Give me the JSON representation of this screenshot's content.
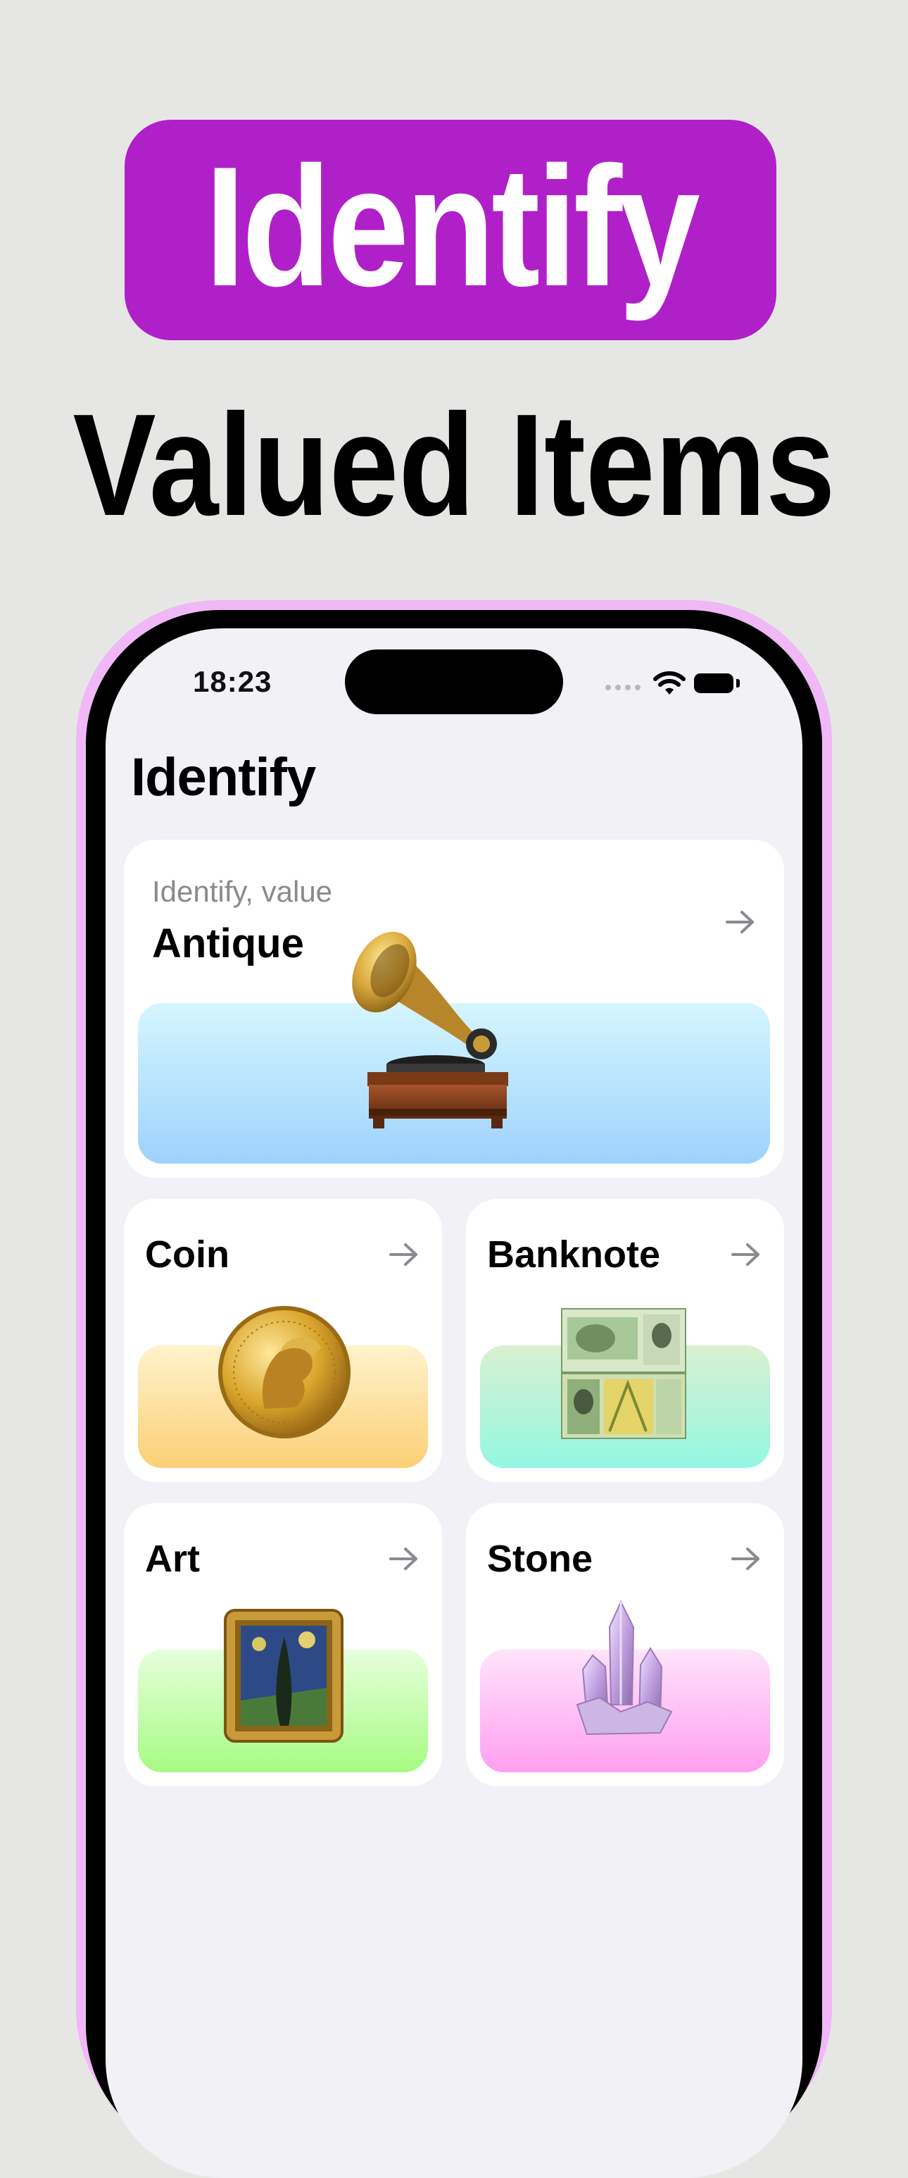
{
  "promo": {
    "pill_text": "Identify",
    "headline": "Valued Items"
  },
  "status_bar": {
    "time": "18:23"
  },
  "screen": {
    "title": "Identify"
  },
  "cards": {
    "antique": {
      "subtitle": "Identify, value",
      "title": "Antique",
      "illustration": "gramophone"
    },
    "coin": {
      "title": "Coin",
      "illustration": "gold-coin"
    },
    "banknote": {
      "title": "Banknote",
      "illustration": "banknote"
    },
    "art": {
      "title": "Art",
      "illustration": "framed-painting"
    },
    "stone": {
      "title": "Stone",
      "illustration": "crystal"
    }
  },
  "colors": {
    "background": "#e6e7e4",
    "pill": "#b020c8",
    "phone_halo": "#f0b8f6",
    "screen_bg": "#f1f1f6"
  }
}
